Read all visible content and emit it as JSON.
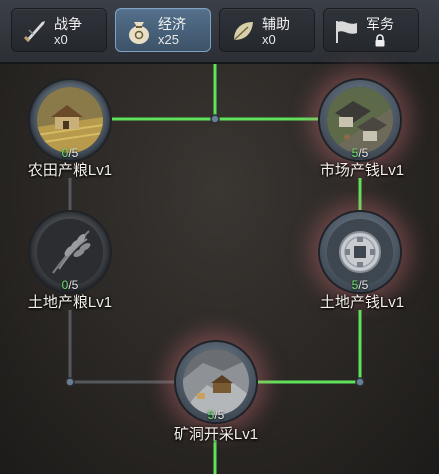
{
  "tabs": [
    {
      "name": "战争",
      "count": "x0",
      "icon": "sword-icon"
    },
    {
      "name": "经济",
      "count": "x25",
      "icon": "money-bag-icon",
      "active": true
    },
    {
      "name": "辅助",
      "count": "x0",
      "icon": "leaf-icon"
    },
    {
      "name": "军务",
      "count": "",
      "icon": "flag-icon",
      "locked": true
    }
  ],
  "nodes": {
    "farm_grain": {
      "label": "农田产粮Lv1",
      "cur": "0",
      "max": "5",
      "icon": "farm-icon"
    },
    "market_coin": {
      "label": "市场产钱Lv1",
      "cur": "5",
      "max": "5",
      "icon": "market-icon"
    },
    "land_grain": {
      "label": "土地产粮Lv1",
      "cur": "0",
      "max": "5",
      "icon": "wheat-icon"
    },
    "land_coin": {
      "label": "土地产钱Lv1",
      "cur": "5",
      "max": "5",
      "icon": "coin-icon"
    },
    "mine": {
      "label": "矿洞开采Lv1",
      "cur": "5",
      "max": "5",
      "icon": "mine-icon"
    }
  },
  "colors": {
    "active_line": "#5ee35a",
    "inactive_line": "#55585c",
    "accent": "#7fa2c4"
  }
}
